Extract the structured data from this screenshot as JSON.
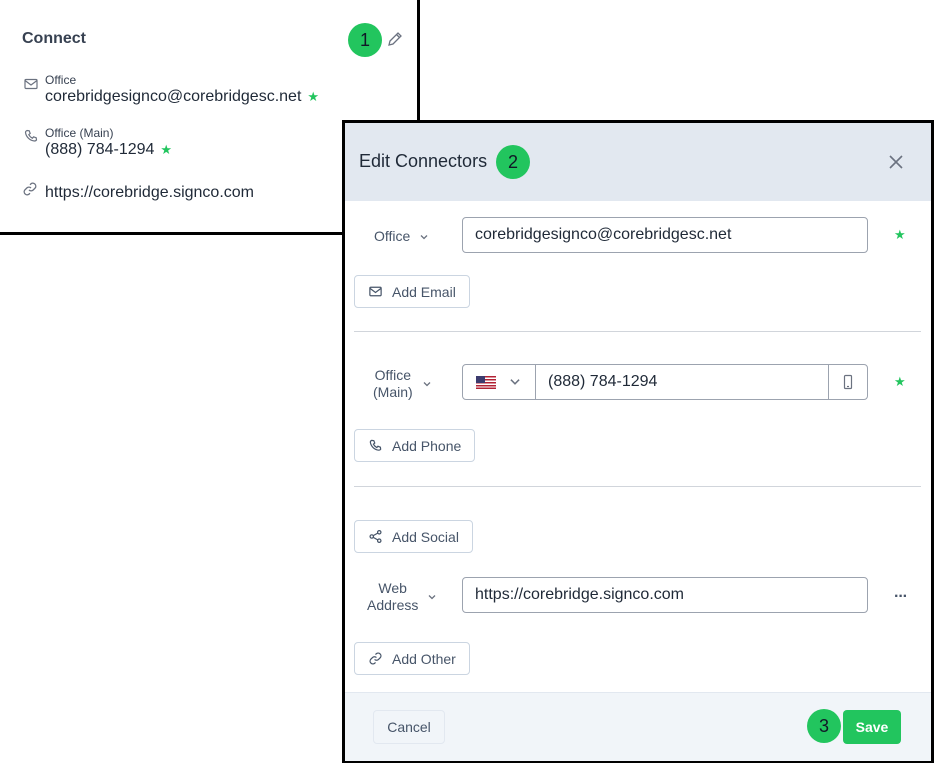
{
  "connect": {
    "title": "Connect",
    "badge": "1",
    "items": [
      {
        "icon": "mail-icon",
        "label": "Office",
        "value": "corebridgesignco@corebridgesc.net",
        "primary": true
      },
      {
        "icon": "phone-icon",
        "label": "Office (Main)",
        "value": "(888) 784-1294",
        "primary": true
      },
      {
        "icon": "link-icon",
        "label": "",
        "value": "https://corebridge.signco.com",
        "primary": false
      }
    ]
  },
  "modal": {
    "title": "Edit Connectors",
    "badge": "2",
    "email": {
      "type": "Office",
      "value": "corebridgesignco@corebridgesc.net",
      "add_label": "Add Email"
    },
    "phone": {
      "type_line1": "Office",
      "type_line2": "(Main)",
      "country": "us-flag",
      "value": "(888) 784-1294",
      "add_label": "Add Phone"
    },
    "social": {
      "add_label": "Add Social"
    },
    "web": {
      "type_line1": "Web",
      "type_line2": "Address",
      "value": "https://corebridge.signco.com",
      "more": "···"
    },
    "other": {
      "add_label": "Add Other"
    },
    "footer": {
      "cancel": "Cancel",
      "save": "Save",
      "badge": "3"
    }
  },
  "colors": {
    "accent": "#22c55e",
    "header_bg": "#e2e8f0"
  }
}
